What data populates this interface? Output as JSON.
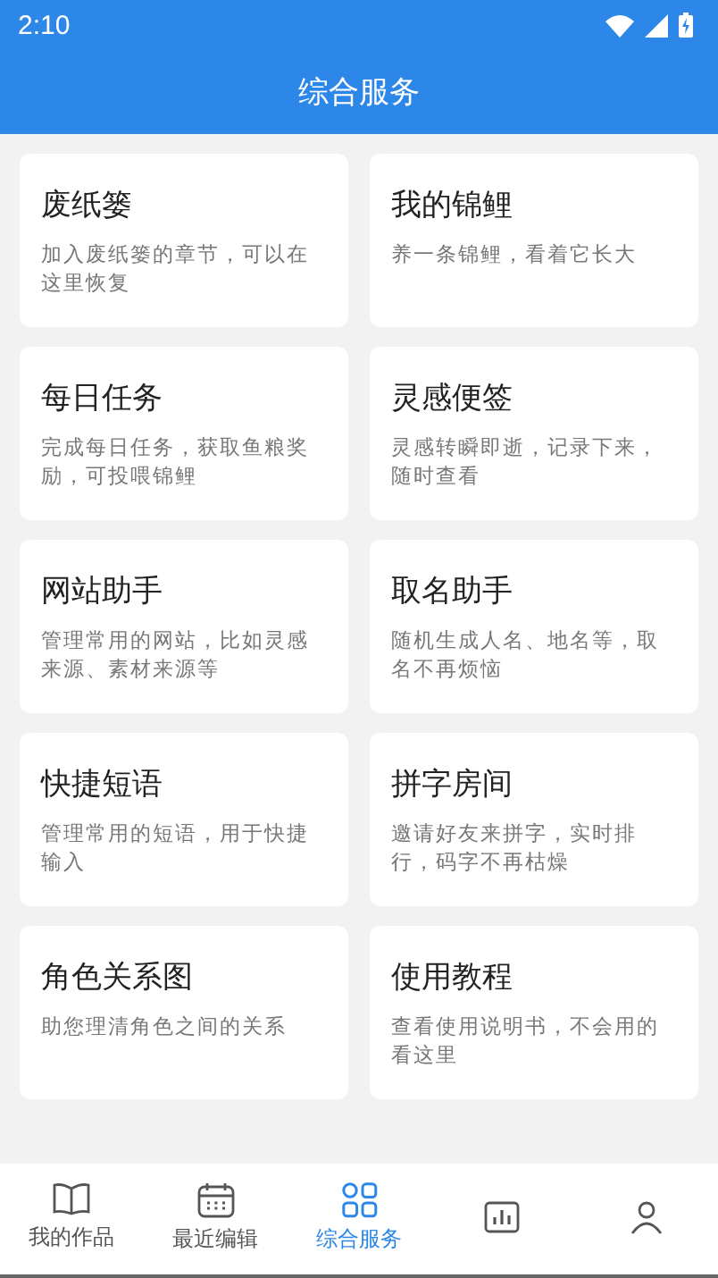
{
  "status_bar": {
    "time": "2:10"
  },
  "header": {
    "title": "综合服务"
  },
  "cards": [
    {
      "title": "废纸篓",
      "description": "加入废纸篓的章节，可以在这里恢复"
    },
    {
      "title": "我的锦鲤",
      "description": "养一条锦鲤，看着它长大"
    },
    {
      "title": "每日任务",
      "description": "完成每日任务，获取鱼粮奖励，可投喂锦鲤"
    },
    {
      "title": "灵感便签",
      "description": "灵感转瞬即逝，记录下来，随时查看"
    },
    {
      "title": "网站助手",
      "description": "管理常用的网站，比如灵感来源、素材来源等"
    },
    {
      "title": "取名助手",
      "description": "随机生成人名、地名等，取名不再烦恼"
    },
    {
      "title": "快捷短语",
      "description": "管理常用的短语，用于快捷输入"
    },
    {
      "title": "拼字房间",
      "description": "邀请好友来拼字，实时排行，码字不再枯燥"
    },
    {
      "title": "角色关系图",
      "description": "助您理清角色之间的关系"
    },
    {
      "title": "使用教程",
      "description": "查看使用说明书，不会用的看这里"
    }
  ],
  "bottom_nav": [
    {
      "kind": "book",
      "label": "我的作品",
      "selected": false
    },
    {
      "kind": "calendar",
      "label": "最近编辑",
      "selected": false
    },
    {
      "kind": "grid",
      "label": "综合服务",
      "selected": true
    },
    {
      "kind": "chart",
      "selected": false
    },
    {
      "kind": "person",
      "selected": false
    }
  ]
}
